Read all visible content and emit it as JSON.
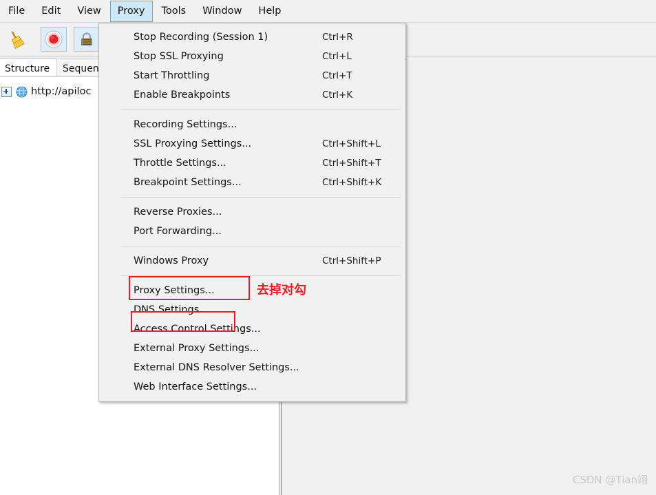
{
  "menubar": {
    "items": [
      {
        "label": "File",
        "active": false
      },
      {
        "label": "Edit",
        "active": false
      },
      {
        "label": "View",
        "active": false
      },
      {
        "label": "Proxy",
        "active": true
      },
      {
        "label": "Tools",
        "active": false
      },
      {
        "label": "Window",
        "active": false
      },
      {
        "label": "Help",
        "active": false
      }
    ]
  },
  "toolbar": {
    "buttons": [
      {
        "name": "clear-session-button",
        "icon": "broom-icon",
        "selected": false
      },
      {
        "name": "record-toggle-button",
        "icon": "record-icon",
        "selected": true
      },
      {
        "name": "ssl-proxying-button",
        "icon": "lock-icon",
        "selected": true
      }
    ]
  },
  "left_panel": {
    "tabs": [
      {
        "label": "Structure",
        "active": true
      },
      {
        "label": "Sequen",
        "active": false
      }
    ],
    "tree": {
      "items": [
        {
          "label": "http://apiloc",
          "icon": "globe-icon",
          "expanded": false
        }
      ]
    }
  },
  "proxy_menu": {
    "groups": [
      {
        "items": [
          {
            "label": "Stop Recording (Session 1)",
            "accel": "Ctrl+R"
          },
          {
            "label": "Stop SSL Proxying",
            "accel": "Ctrl+L"
          },
          {
            "label": "Start Throttling",
            "accel": "Ctrl+T"
          },
          {
            "label": "Enable Breakpoints",
            "accel": "Ctrl+K"
          }
        ]
      },
      {
        "items": [
          {
            "label": "Recording Settings...",
            "accel": ""
          },
          {
            "label": "SSL Proxying Settings...",
            "accel": "Ctrl+Shift+L"
          },
          {
            "label": "Throttle Settings...",
            "accel": "Ctrl+Shift+T"
          },
          {
            "label": "Breakpoint Settings...",
            "accel": "Ctrl+Shift+K"
          }
        ]
      },
      {
        "items": [
          {
            "label": "Reverse Proxies...",
            "accel": ""
          },
          {
            "label": "Port Forwarding...",
            "accel": ""
          }
        ]
      },
      {
        "items": [
          {
            "label": "Windows Proxy",
            "accel": "Ctrl+Shift+P"
          }
        ]
      },
      {
        "items": [
          {
            "label": "Proxy Settings...",
            "accel": ""
          },
          {
            "label": "DNS Settings...",
            "accel": ""
          },
          {
            "label": "Access Control Settings...",
            "accel": ""
          },
          {
            "label": "External Proxy Settings...",
            "accel": ""
          },
          {
            "label": "External DNS Resolver Settings...",
            "accel": ""
          },
          {
            "label": "Web Interface Settings...",
            "accel": ""
          }
        ]
      }
    ]
  },
  "annotations": {
    "note_text": "去掉对勾",
    "highlight_color": "#ed1c24",
    "boxes": [
      {
        "target": "Windows Proxy"
      },
      {
        "target": "Proxy Settings..."
      }
    ]
  },
  "watermark": {
    "text": "CSDN @Tian翊"
  }
}
